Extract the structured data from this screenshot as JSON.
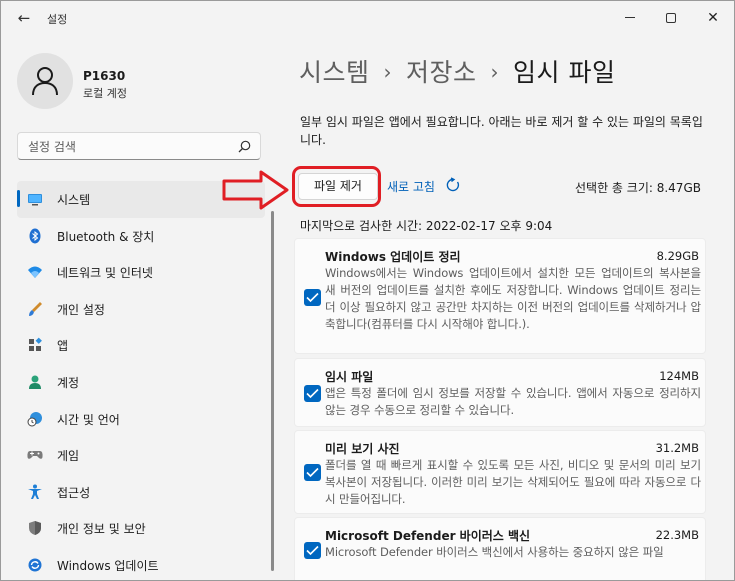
{
  "window": {
    "title": "설정",
    "back_glyph": "←",
    "minimize_glyph": "",
    "maximize_glyph": "",
    "close_glyph": "✕"
  },
  "user": {
    "name": "P1630",
    "account_type": "로컬 계정"
  },
  "search": {
    "placeholder": "설정 검색"
  },
  "sidebar": {
    "items": [
      {
        "label": "시스템",
        "icon": "monitor-icon",
        "active": true
      },
      {
        "label": "Bluetooth & 장치",
        "icon": "bluetooth-icon"
      },
      {
        "label": "네트워크 및 인터넷",
        "icon": "wifi-icon"
      },
      {
        "label": "개인 설정",
        "icon": "brush-icon"
      },
      {
        "label": "앱",
        "icon": "apps-icon"
      },
      {
        "label": "계정",
        "icon": "account-icon"
      },
      {
        "label": "시간 및 언어",
        "icon": "clock-globe-icon"
      },
      {
        "label": "게임",
        "icon": "gamepad-icon"
      },
      {
        "label": "접근성",
        "icon": "accessibility-icon"
      },
      {
        "label": "개인 정보 및 보안",
        "icon": "shield-icon"
      },
      {
        "label": "Windows 업데이트",
        "icon": "windows-update-icon"
      }
    ]
  },
  "breadcrumb": {
    "level1": "시스템",
    "level2": "저장소",
    "current": "임시 파일",
    "separator": "›"
  },
  "intro": "일부 임시 파일은 앱에서 필요합니다. 아래는 바로 제거 할 수 있는 파일의 목록입니다.",
  "actions": {
    "remove_label": "파일 제거",
    "refresh_label": "새로 고침"
  },
  "total_selected": "선택한 총 크기: 8.47GB",
  "last_scan": "마지막으로 검사한 시간: 2022-02-17 오후 9:04",
  "colors": {
    "accent": "#0067c0",
    "highlight": "#e01e24",
    "link": "#0060b8"
  },
  "items": [
    {
      "title": "Windows 업데이트 정리",
      "size": "8.29GB",
      "checked": true,
      "description": "Windows에서는 Windows 업데이트에서 설치한 모든 업데이트의 복사본을 새 버전의 업데이트를 설치한 후에도 저장합니다. Windows 업데이트 정리는 더 이상 필요하지 않고 공간만 차지하는 이전 버전의 업데이트를 삭제하거나 압축합니다(컴퓨터를 다시 시작해야 합니다.)."
    },
    {
      "title": "임시 파일",
      "size": "124MB",
      "checked": true,
      "description": "앱은 특정 폴더에 임시 정보를 저장할 수 있습니다. 앱에서 자동으로 정리하지 않는 경우 수동으로 정리할 수 있습니다."
    },
    {
      "title": "미리 보기 사진",
      "size": "31.2MB",
      "checked": true,
      "description": "폴더를 열 때 빠르게 표시할 수 있도록 모든 사진, 비디오 및 문서의 미리 보기 복사본이 저장됩니다. 이러한 미리 보기는 삭제되어도 필요에 따라 자동으로 다시 만들어집니다."
    },
    {
      "title": "Microsoft Defender 바이러스 백신",
      "size": "22.3MB",
      "checked": true,
      "description": "Microsoft Defender 바이러스 백신에서 사용하는 중요하지 않은 파일"
    }
  ]
}
